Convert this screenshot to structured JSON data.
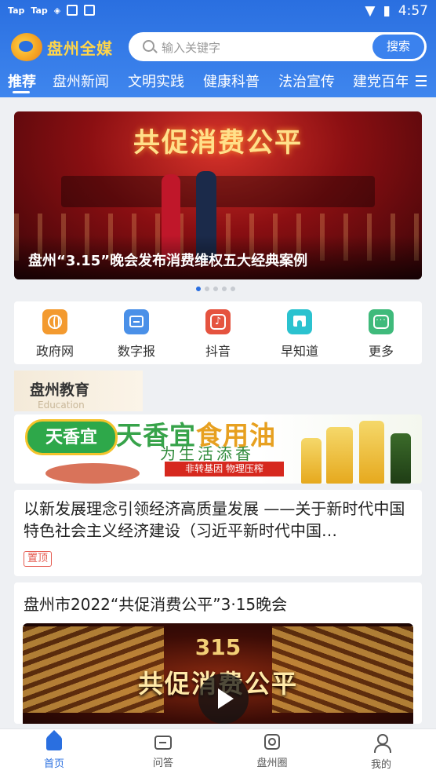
{
  "status_bar": {
    "app_badges": [
      "Tap",
      "Tap"
    ],
    "time": "4:57"
  },
  "header": {
    "logo_text": "盘州全媒",
    "search": {
      "placeholder": "输入关键字",
      "button": "搜索"
    }
  },
  "tabs": [
    {
      "label": "推荐",
      "active": true
    },
    {
      "label": "盘州新闻"
    },
    {
      "label": "文明实践"
    },
    {
      "label": "健康科普"
    },
    {
      "label": "法治宣传"
    },
    {
      "label": "建党百年"
    }
  ],
  "banner": {
    "stage_title": "共促消费公平",
    "caption": "盘州“3.15”晚会发布消费维权五大经典案例",
    "slide_count": 5,
    "active_slide": 1
  },
  "quick_nav": [
    {
      "label": "政府网",
      "icon": "globe-icon",
      "color": "#f39a2f"
    },
    {
      "label": "数字报",
      "icon": "newspaper-icon",
      "color": "#4a90e8"
    },
    {
      "label": "抖音",
      "icon": "douyin-icon",
      "color": "#e5533f"
    },
    {
      "label": "早知道",
      "icon": "home-icon",
      "color": "#2bc2cf"
    },
    {
      "label": "更多",
      "icon": "more-icon",
      "color": "#3fba7b"
    }
  ],
  "section": {
    "title": "盘州教育",
    "subtitle": "Education"
  },
  "ad": {
    "brand": "天香宜",
    "headline_main": "天香宜",
    "headline_accent": "食用油",
    "slogan": "为生活添香",
    "tagline": "非转基因 物理压榨"
  },
  "articles": [
    {
      "title": "以新发展理念引领经济高质量发展 ——关于新时代中国特色社会主义经济建设（习近平新时代中国…",
      "tag": "置顶"
    },
    {
      "title": "盘州市2022“共促消费公平”3·15晚会",
      "thumb_title": "315",
      "thumb_subtitle": "共促消费公平"
    }
  ],
  "bottom_nav": [
    {
      "label": "首页",
      "icon": "home-icon",
      "active": true
    },
    {
      "label": "问答",
      "icon": "chat-icon"
    },
    {
      "label": "盘州圈",
      "icon": "circle-icon"
    },
    {
      "label": "我的",
      "icon": "user-icon"
    }
  ],
  "colors": {
    "primary": "#2a6fe0",
    "pin_tag": "#e55a4f"
  }
}
